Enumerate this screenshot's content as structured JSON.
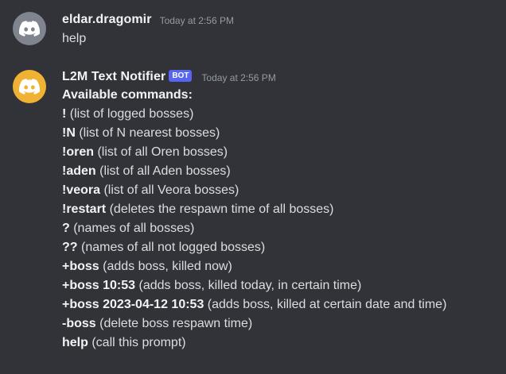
{
  "messages": [
    {
      "username": "eldar.dragomir",
      "timestamp": "Today at 2:56 PM",
      "avatar_color": "#80848e",
      "avatar_icon": "discord-logo-icon",
      "text": "help"
    },
    {
      "username": "L2M Text Notifier",
      "bot_tag": "BOT",
      "timestamp": "Today at 2:56 PM",
      "avatar_color": "#f0b232",
      "avatar_icon": "discord-logo-icon",
      "title": "Available commands:",
      "commands": [
        {
          "cmd": "!",
          "desc": " (list of logged bosses)"
        },
        {
          "cmd": "!N",
          "desc": " (list of N nearest bosses)"
        },
        {
          "cmd": "!oren",
          "desc": " (list of all Oren bosses)"
        },
        {
          "cmd": "!aden",
          "desc": " (list of all Aden bosses)"
        },
        {
          "cmd": "!veora",
          "desc": " (list of all Veora bosses)"
        },
        {
          "cmd": "!restart",
          "desc": " (deletes the respawn time of all bosses)"
        },
        {
          "cmd": "?",
          "desc": " (names of all bosses)"
        },
        {
          "cmd": "??",
          "desc": " (names of all not logged bosses)"
        },
        {
          "cmd": "+boss",
          "desc": " (adds boss, killed now)"
        },
        {
          "cmd": "+boss 10:53",
          "desc": " (adds boss, killed today, in certain time)"
        },
        {
          "cmd": "+boss 2023-04-12 10:53",
          "desc": " (adds boss, killed at certain date and time)"
        },
        {
          "cmd": "-boss",
          "desc": " (delete boss respawn time)"
        },
        {
          "cmd": "help",
          "desc": " (call this prompt)"
        }
      ]
    }
  ],
  "colors": {
    "background": "#313338",
    "text": "#dbdee1",
    "header_text": "#f2f3f5",
    "timestamp": "#949ba4",
    "bot_tag": "#5865f2"
  }
}
